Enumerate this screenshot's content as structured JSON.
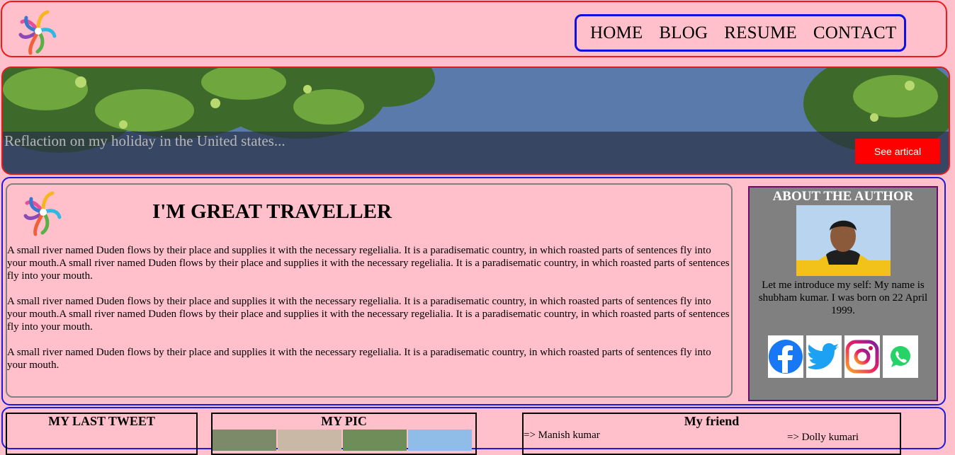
{
  "nav": {
    "items": [
      "HOME",
      "BLOG",
      "RESUME",
      "CONTACT"
    ]
  },
  "hero": {
    "caption": "Reflaction on my holiday in the United states...",
    "button_label": "See artical"
  },
  "article": {
    "title": "I'M GREAT TRAVELLER",
    "paragraphs": [
      "A small river named Duden flows by their place and supplies it with the necessary regelialia. It is a paradisematic country, in which roasted parts of sentences fly into your mouth.A small river named Duden flows by their place and supplies it with the necessary regelialia. It is a paradisematic country, in which roasted parts of sentences fly into your mouth.",
      "A small river named Duden flows by their place and supplies it with the necessary regelialia. It is a paradisematic country, in which roasted parts of sentences fly into your mouth.A small river named Duden flows by their place and supplies it with the necessary regelialia. It is a paradisematic country, in which roasted parts of sentences fly into your mouth.",
      "A small river named Duden flows by their place and supplies it with the necessary regelialia. It is a paradisematic country, in which roasted parts of sentences fly into your mouth."
    ]
  },
  "author": {
    "heading": "ABOUT THE AUTHOR",
    "bio": "Let me introduce my self: My name is shubham kumar. I was born on 22 April 1999.",
    "social": [
      "facebook-icon",
      "twitter-icon",
      "instagram-icon",
      "whatsapp-icon"
    ]
  },
  "bottom": {
    "tweet_heading": "MY LAST TWEET",
    "pic_heading": "MY PIC",
    "friend_heading": "My friend",
    "friends": [
      "=> Manish kumar",
      "=> Dolly kumari"
    ]
  },
  "colors": {
    "page_bg": "#ffc0cb",
    "header_border": "#f01a1a",
    "nav_border": "#1010e0",
    "button": "#ff0000",
    "author_bg": "#808080"
  }
}
